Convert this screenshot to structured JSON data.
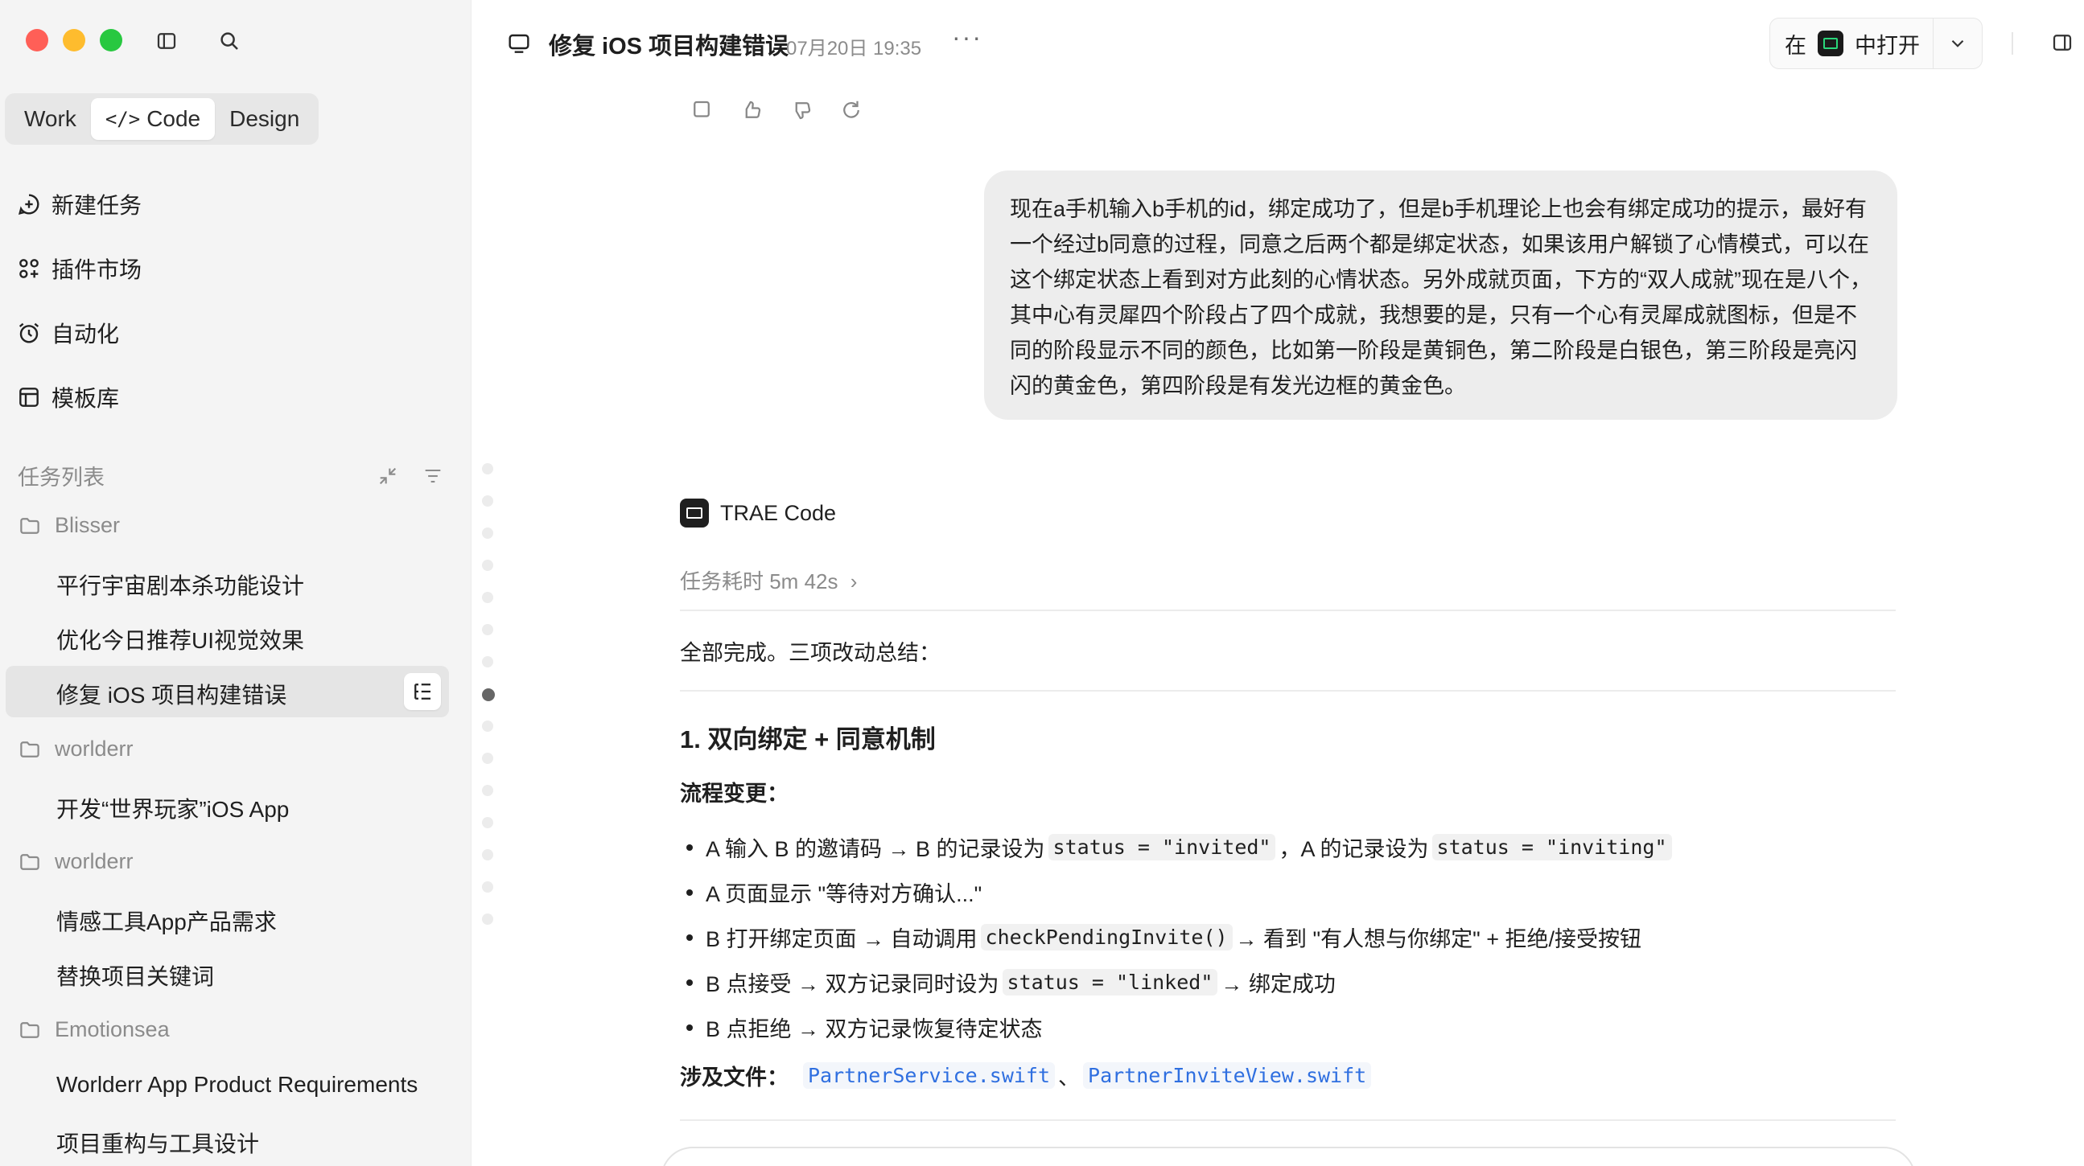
{
  "sidebar": {
    "modes": [
      "Work",
      "Code",
      "Design"
    ],
    "code_icon": "</>",
    "nav": [
      "新建任务",
      "插件市场",
      "自动化",
      "模板库"
    ],
    "section_title": "任务列表",
    "groups": [
      {
        "name": "Blisser",
        "tasks": [
          "平行宇宙剧本杀功能设计",
          "优化今日推荐UI视觉效果",
          "修复 iOS 项目构建错误"
        ]
      },
      {
        "name": "worlderr",
        "tasks": [
          "开发“世界玩家”iOS App"
        ]
      },
      {
        "name": "worlderr",
        "tasks": [
          "情感工具App产品需求",
          "替换项目关键词"
        ]
      },
      {
        "name": "Emotionsea",
        "tasks": [
          "Worlderr App Product Requirements",
          "项目重构与工具设计"
        ]
      }
    ]
  },
  "header": {
    "title": "修复 iOS 项目构建错误",
    "time": "07月20日 19:35",
    "more": "···",
    "open_prefix": "在",
    "open_suffix": "中打开"
  },
  "chat": {
    "user_message": "现在a手机输入b手机的id，绑定成功了，但是b手机理论上也会有绑定成功的提示，最好有一个经过b同意的过程，同意之后两个都是绑定状态，如果该用户解锁了心情模式，可以在这个绑定状态上看到对方此刻的心情状态。另外成就页面，下方的“双人成就”现在是八个，其中心有灵犀四个阶段占了四个成就，我想要的是，只有一个心有灵犀成就图标，但是不同的阶段显示不同的颜色，比如第一阶段是黄铜色，第二阶段是白银色，第三阶段是亮闪闪的黄金色，第四阶段是有发光边框的黄金色。",
    "bot_name": "TRAE Code",
    "duration": "任务耗时 5m 42s",
    "duration_chevron": "›",
    "summary": "全部完成。三项改动总结：",
    "heading": "1. 双向绑定 + 同意机制",
    "subheading": "流程变更：",
    "bullets": [
      {
        "t1": "A 输入 B 的邀请码 → B 的记录设为",
        "c1": "status = \"invited\"",
        "t2": "，A 的记录设为",
        "c2": "status = \"inviting\"",
        "t3": ""
      },
      {
        "t1": "A 页面显示 \"等待对方确认...\"",
        "c1": "",
        "t2": "",
        "c2": "",
        "t3": ""
      },
      {
        "t1": "B 打开绑定页面 → 自动调用",
        "c1": "checkPendingInvite()",
        "t2": "→ 看到 \"有人想与你绑定\" + 拒绝/接受按钮",
        "c2": "",
        "t3": ""
      },
      {
        "t1": "B 点接受 → 双方记录同时设为",
        "c1": "status = \"linked\"",
        "t2": "→ 绑定成功",
        "c2": "",
        "t3": ""
      },
      {
        "t1": "B 点拒绝 → 双方记录恢复待定状态",
        "c1": "",
        "t2": "",
        "c2": "",
        "t3": ""
      }
    ],
    "files_label": "涉及文件：",
    "file1": "PartnerService.swift",
    "file_sep": "、",
    "file2": "PartnerInviteView.swift"
  },
  "colors": {
    "accent_code": "#2f6fe0",
    "trae_green": "#2ad67a",
    "close": "#ff5f57",
    "minimize": "#febc2e",
    "zoom": "#28c840"
  }
}
